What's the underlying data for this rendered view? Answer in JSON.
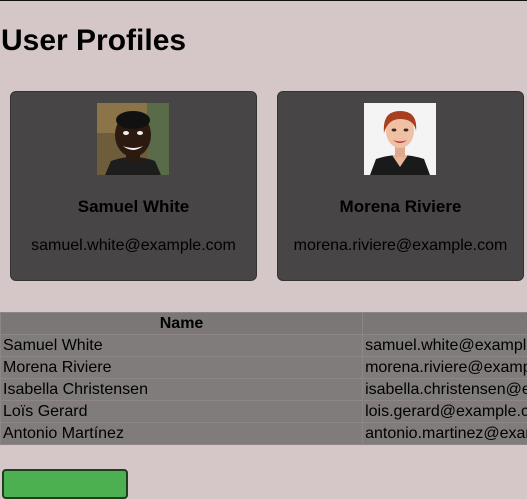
{
  "page": {
    "title": "User Profiles"
  },
  "profiles": [
    {
      "name": "Samuel White",
      "email": "samuel.white@example.com",
      "avatar_icon": "person-photo-icon"
    },
    {
      "name": "Morena Riviere",
      "email": "morena.riviere@example.com",
      "avatar_icon": "person-photo-icon"
    }
  ],
  "table": {
    "headers": [
      "Name",
      ""
    ],
    "rows": [
      {
        "name": "Samuel White",
        "email": "samuel.white@example.com"
      },
      {
        "name": "Morena Riviere",
        "email": "morena.riviere@example.com"
      },
      {
        "name": "Isabella Christensen",
        "email": "isabella.christensen@example.com"
      },
      {
        "name": "Loïs Gerard",
        "email": "lois.gerard@example.com"
      },
      {
        "name": "Antonio Martínez",
        "email": "antonio.martinez@example.com"
      }
    ]
  },
  "actions": {
    "add_label": ""
  },
  "colors": {
    "background": "#d5c7c7",
    "card": "#474545",
    "table_cell": "#807c7b",
    "table_header": "#7b7777",
    "button": "#4caf50"
  }
}
